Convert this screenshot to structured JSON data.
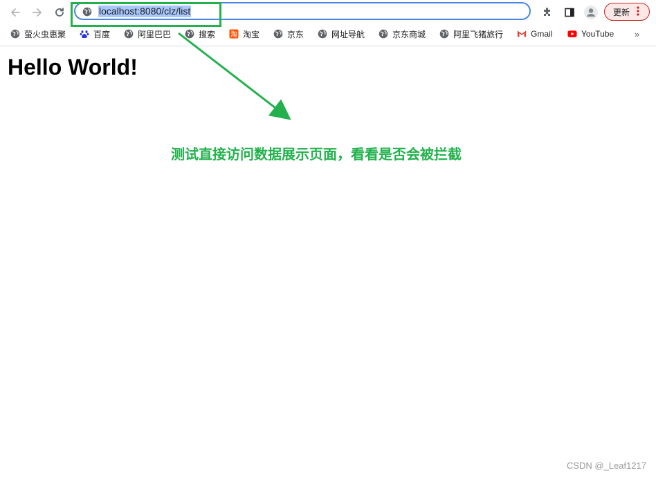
{
  "browser": {
    "url": "localhost:8080/clz/list",
    "update_label": "更新"
  },
  "bookmarks": [
    {
      "label": "萤火虫惠聚",
      "icon": "globe-icon"
    },
    {
      "label": "百度",
      "icon": "baidu-paw-icon"
    },
    {
      "label": "阿里巴巴",
      "icon": "globe-icon"
    },
    {
      "label": "搜索",
      "icon": "globe-icon"
    },
    {
      "label": "淘宝",
      "icon": "taobao-icon"
    },
    {
      "label": "京东",
      "icon": "globe-icon"
    },
    {
      "label": "网址导航",
      "icon": "globe-icon"
    },
    {
      "label": "京东商城",
      "icon": "globe-icon"
    },
    {
      "label": "阿里飞猪旅行",
      "icon": "globe-icon"
    },
    {
      "label": "Gmail",
      "icon": "gmail-icon"
    },
    {
      "label": "YouTube",
      "icon": "youtube-icon"
    }
  ],
  "page": {
    "heading": "Hello World!"
  },
  "annotation": {
    "note": "测试直接访问数据展示页面，看看是否会被拦截",
    "color": "#22b14c"
  },
  "watermark": "CSDN @_Leaf1217"
}
